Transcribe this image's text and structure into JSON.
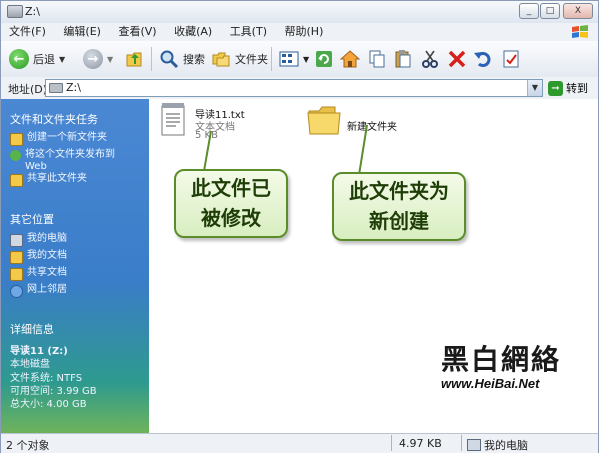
{
  "window": {
    "title": "Z:\\"
  },
  "window_buttons": [
    "_",
    "□",
    "X"
  ],
  "menu": [
    "文件(F)",
    "编辑(E)",
    "查看(V)",
    "收藏(A)",
    "工具(T)",
    "帮助(H)"
  ],
  "toolbar": {
    "back_label": "后退",
    "search_label": "搜索",
    "folders_label": "文件夹"
  },
  "address": {
    "label": "地址(D)",
    "value": "Z:\\",
    "go_label": "转到"
  },
  "sidebar": {
    "tasks_title": "文件和文件夹任务",
    "tasks": [
      "创建一个新文件夹",
      "将这个文件夹发布到 Web",
      "共享此文件夹"
    ],
    "places_title": "其它位置",
    "places": [
      "我的电脑",
      "我的文档",
      "共享文档",
      "网上邻居"
    ],
    "details_title": "详细信息",
    "details": {
      "name": "导读11 (Z:)",
      "type": "本地磁盘",
      "fs": "文件系统: NTFS",
      "free": "可用空间: 3.99 GB",
      "total": "总大小: 4.00 GB"
    }
  },
  "files": [
    {
      "name": "导读11.txt",
      "type": "文本文档",
      "size": "5 KB"
    },
    {
      "name": "新建文件夹"
    }
  ],
  "callouts": {
    "left": [
      "此文件已",
      "被修改"
    ],
    "right": [
      "此文件夹为",
      "新创建"
    ]
  },
  "watermark": {
    "brand": "黑白網絡",
    "url": "www.HeiBai.Net"
  },
  "status": {
    "objects": "2 个对象",
    "size": "4.97 KB",
    "location": "我的电脑"
  }
}
